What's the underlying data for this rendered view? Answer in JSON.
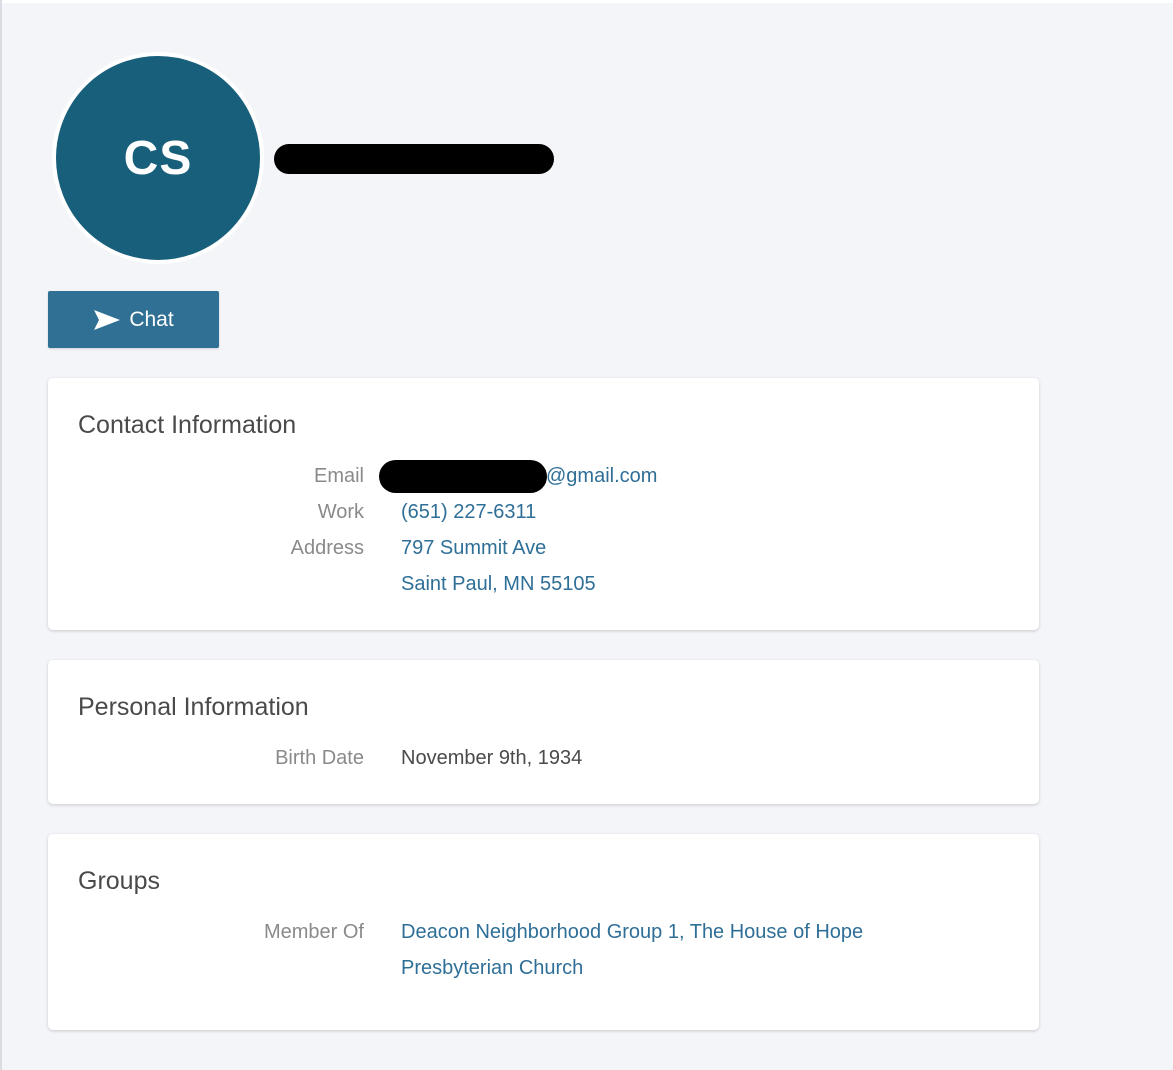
{
  "profile": {
    "initials": "CS",
    "chat_label": "Chat"
  },
  "contact": {
    "title": "Contact Information",
    "email_label": "Email",
    "email_domain": "@gmail.com",
    "work_label": "Work",
    "work_phone": "(651) 227-6311",
    "address_label": "Address",
    "address_line1": "797 Summit Ave",
    "address_line2": "Saint Paul, MN 55105"
  },
  "personal": {
    "title": "Personal Information",
    "birth_label": "Birth Date",
    "birth_date": "November 9th, 1934"
  },
  "groups": {
    "title": "Groups",
    "member_label": "Member Of",
    "member_line1": "Deacon Neighborhood Group 1, The House of Hope",
    "member_line2": "Presbyterian Church"
  },
  "icons": {
    "chat": "send-icon"
  },
  "colors": {
    "avatar": "#175f7a",
    "button": "#2f7094",
    "link": "#2f6f97",
    "background": "#f3f5f8"
  }
}
